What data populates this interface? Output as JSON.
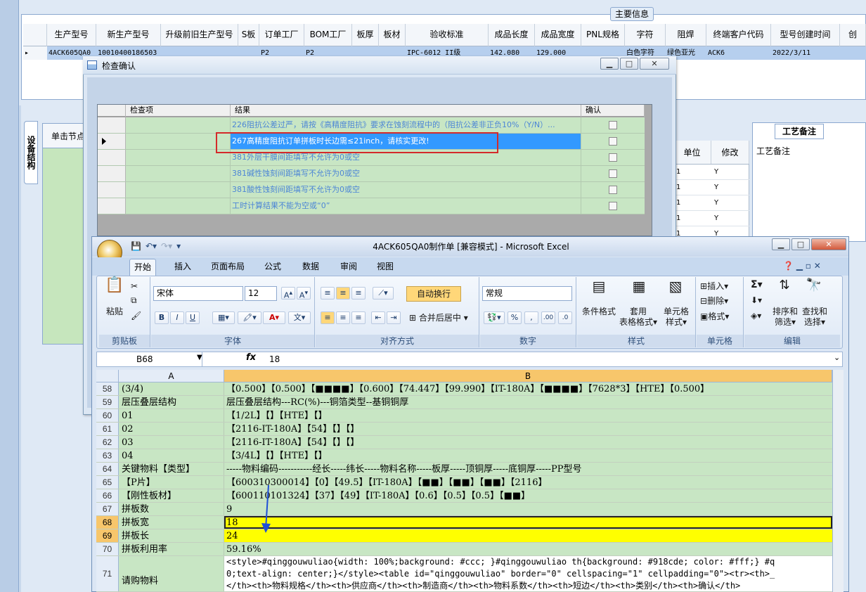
{
  "main_panel": {
    "legend": "主要信息",
    "columns": [
      "生产型号",
      "新生产型号",
      "升级前旧生产型号",
      "S板",
      "订单工厂",
      "BOM工厂",
      "板厚",
      "板材",
      "验收标准",
      "成品长度",
      "成品宽度",
      "PNL规格",
      "字符",
      "阻焊",
      "终端客户代码",
      "型号创建时间",
      "创"
    ],
    "row": [
      "4ACK605QA0",
      "10010400186503",
      "",
      "",
      "P2",
      "P2",
      "",
      "",
      "IPC-6012 II级",
      "142.080",
      "129.000",
      "",
      "白色字符",
      "绿色亚光",
      "ACK6",
      "2022/3/11",
      ""
    ]
  },
  "side": {
    "vtab": "设备结构",
    "sub_header": "单击节点"
  },
  "right_grid": {
    "headers": [
      "单位",
      "修改"
    ],
    "rows": [
      [
        "1",
        "Y"
      ],
      [
        "1",
        "Y"
      ],
      [
        "1",
        "Y"
      ],
      [
        "1",
        "Y"
      ],
      [
        "1",
        "Y"
      ]
    ]
  },
  "remark": {
    "tab": "工艺备注",
    "label": "工艺备注"
  },
  "dialog": {
    "title": "检查确认",
    "headers": [
      "检查项",
      "结果",
      "确认"
    ],
    "rows": [
      {
        "item": "",
        "result": "226阻抗公差过严，请按《高精度阻抗》要求在蚀刻流程中的（阻抗公差非正负10%（Y/N）...",
        "selected": false
      },
      {
        "item": "",
        "result": "267高精度阻抗订单拼板时长边需≤21inch，请核实更改!",
        "selected": true
      },
      {
        "item": "",
        "result": "381外层干膜间距填写不允许为0或空",
        "selected": false
      },
      {
        "item": "",
        "result": "381碱性蚀刻间距填写不允许为0或空",
        "selected": false
      },
      {
        "item": "",
        "result": "381酸性蚀刻间距填写不允许为0或空",
        "selected": false
      },
      {
        "item": "",
        "result": "工时计算结果不能为空或“0”",
        "selected": false
      }
    ]
  },
  "excel": {
    "title": "4ACK605QA0制作单 [兼容模式] - Microsoft Excel",
    "tabs": [
      "开始",
      "插入",
      "页面布局",
      "公式",
      "数据",
      "审阅",
      "视图"
    ],
    "font_name": "宋体",
    "font_size": "12",
    "number_format": "常规",
    "buttons": {
      "paste": "粘贴",
      "wrap": "自动换行",
      "merge": "合并后居中",
      "cond_format": "条件格式",
      "table_format_1": "套用",
      "table_format_2": "表格格式",
      "cell_style_1": "单元格",
      "cell_style_2": "样式",
      "insert": "插入",
      "delete": "删除",
      "format": "格式",
      "sort_1": "排序和",
      "sort_2": "筛选",
      "find_1": "查找和",
      "find_2": "选择"
    },
    "groups": [
      "剪贴板",
      "字体",
      "对齐方式",
      "数字",
      "样式",
      "单元格",
      "编辑"
    ],
    "name_box": "B68",
    "formula": "18",
    "col_headers": [
      "A",
      "B"
    ],
    "rows": [
      {
        "n": "58",
        "a": "(3/4)",
        "b": "【0.500】【0.500】【■■■■】【0.600】【74.447】【99.990】【IT-180A】【■■■■】【7628*3】【HTE】【0.500】",
        "hl": false
      },
      {
        "n": "59",
        "a": "层压叠层结构",
        "b": "层压叠层结构---RC(%)---铜箔类型--基铜铜厚",
        "hl": false
      },
      {
        "n": "60",
        "a": "01",
        "b": "【1/2L】【】【HTE】【】",
        "hl": false
      },
      {
        "n": "61",
        "a": "02",
        "b": "【2116-IT-180A】【54】【】【】",
        "hl": false
      },
      {
        "n": "62",
        "a": "03",
        "b": "【2116-IT-180A】【54】【】【】",
        "hl": false
      },
      {
        "n": "63",
        "a": "04",
        "b": "【3/4L】【】【HTE】【】",
        "hl": false
      },
      {
        "n": "64",
        "a": "关键物料【类型】",
        "b": "-----物料编码-----------经长-----纬长-----物料名称-----板厚-----顶铜厚-----底铜厚-----PP型号",
        "hl": false
      },
      {
        "n": "65",
        "a": "【P片】",
        "b": "【600310300014】【0】【49.5】【IT-180A】【■■】【■■】【■■】【2116】",
        "hl": false
      },
      {
        "n": "66",
        "a": "【刚性板材】",
        "b": "【600110101324】【37】【49】【IT-180A】【0.6】【0.5】【0.5】【■■】",
        "hl": false
      },
      {
        "n": "67",
        "a": "拼板数",
        "b": "9",
        "hl": false
      },
      {
        "n": "68",
        "a": "拼板宽",
        "b": "18",
        "hl": true
      },
      {
        "n": "69",
        "a": "拼板长",
        "b": "24",
        "hl": true
      },
      {
        "n": "70",
        "a": "拼板利用率",
        "b": "59.16%",
        "hl": false
      }
    ],
    "row71": {
      "n": "71",
      "a": "请购物料",
      "b1": "<style>#qinggouwuliao{width: 100%;background: #ccc; }#qinggouwuliao th{background: #918cde; color: #fff;} #q",
      "b2": "0;text-align: center;}</style><table id=\"qinggouwuliao\" border=\"0\" cellspacing=\"1\" cellpadding=\"0\"><tr><th>_",
      "b3": "</th><th>物料规格</th><th>供应商</th><th>制造商</th><th>物料系数</th><th>短边</th><th>类别</th><th>确认</th>"
    }
  },
  "colors": {
    "highlight": "#ffff00",
    "cell_green": "#c8e6c4",
    "selection": "#3399ff",
    "annotation": "#d42a2a"
  }
}
